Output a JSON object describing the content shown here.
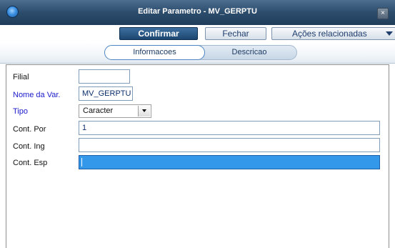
{
  "window": {
    "title": "Editar Parametro - MV_GERPTU",
    "close_glyph": "×",
    "app_icon": "app-logo-icon"
  },
  "toolbar": {
    "confirm_label": "Confirmar",
    "close_label": "Fechar",
    "actions_label": "Ações relacionadas"
  },
  "tabs": [
    {
      "label": "Informacoes"
    },
    {
      "label": "Descricao"
    }
  ],
  "form": {
    "filial": {
      "label": "Filial",
      "value": ""
    },
    "nome_var": {
      "label": "Nome da Var.",
      "value": "MV_GERPTU"
    },
    "tipo": {
      "label": "Tipo",
      "value": "Caracter"
    },
    "cont_por": {
      "label": "Cont. Por",
      "value": "1"
    },
    "cont_ing": {
      "label": "Cont. Ing",
      "value": ""
    },
    "cont_esp": {
      "label": "Cont. Esp",
      "value": ""
    }
  },
  "colors": {
    "title_bar": "#2d4d6d",
    "confirm_button": "#1c4670",
    "required_label": "#1a1acb",
    "selected_field": "#3398ea"
  }
}
